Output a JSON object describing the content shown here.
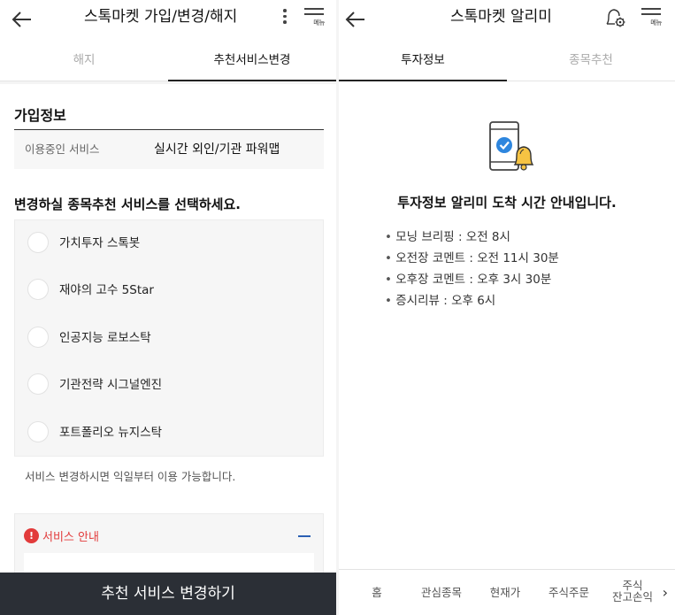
{
  "left": {
    "header": {
      "title": "스톡마켓 가입/변경/해지",
      "menu_label": "메뉴"
    },
    "tabs": [
      {
        "label": "해지",
        "active": false
      },
      {
        "label": "추천서비스변경",
        "active": true
      }
    ],
    "subscription": {
      "section_title": "가입정보",
      "label": "이용중인 서비스",
      "value": "실시간 외인/기관 파워맵"
    },
    "change": {
      "question": "변경하실 종목추천 서비스를 선택하세요.",
      "options": [
        {
          "label": "가치투자 스톡봇"
        },
        {
          "label": "재야의 고수 5Star"
        },
        {
          "label": "인공지능 로보스탁"
        },
        {
          "label": "기관전략 시그널엔진"
        },
        {
          "label": "포트폴리오 뉴지스탁"
        }
      ],
      "note": "서비스 변경하시면 익일부터 이용 가능합니다."
    },
    "notice": {
      "title": "서비스 안내"
    },
    "cta_label": "추천 서비스 변경하기"
  },
  "right": {
    "header": {
      "title": "스톡마켓 알리미",
      "menu_label": "메뉴"
    },
    "tabs": [
      {
        "label": "투자정보",
        "active": true
      },
      {
        "label": "종목추천",
        "active": false
      }
    ],
    "info_title": "투자정보 알리미 도착 시간 안내입니다.",
    "schedule": [
      "모닝 브리핑 : 오전 8시",
      "오전장 코멘트 : 오전 11시 30분",
      "오후장 코멘트 : 오후 3시 30분",
      "증시리뷰 : 오후 6시"
    ],
    "bottom_nav": [
      {
        "label": "홈"
      },
      {
        "label": "관심종목"
      },
      {
        "label": "현재가"
      },
      {
        "label": "주식주문"
      },
      {
        "line1": "주식",
        "line2": "잔고손익"
      }
    ]
  },
  "colors": {
    "accent_red": "#e23b3b",
    "cta_bg": "#2b2f36",
    "notice_minus": "#2b5fb3",
    "check_blue": "#2e86de",
    "bell_yellow": "#f6c343"
  },
  "icons": [
    "back-arrow-icon",
    "kebab-menu-icon",
    "hamburger-menu-icon",
    "alarm-settings-icon",
    "phone-check-bell-icon",
    "exclamation-icon",
    "collapse-minus-icon",
    "chevron-right-icon"
  ]
}
